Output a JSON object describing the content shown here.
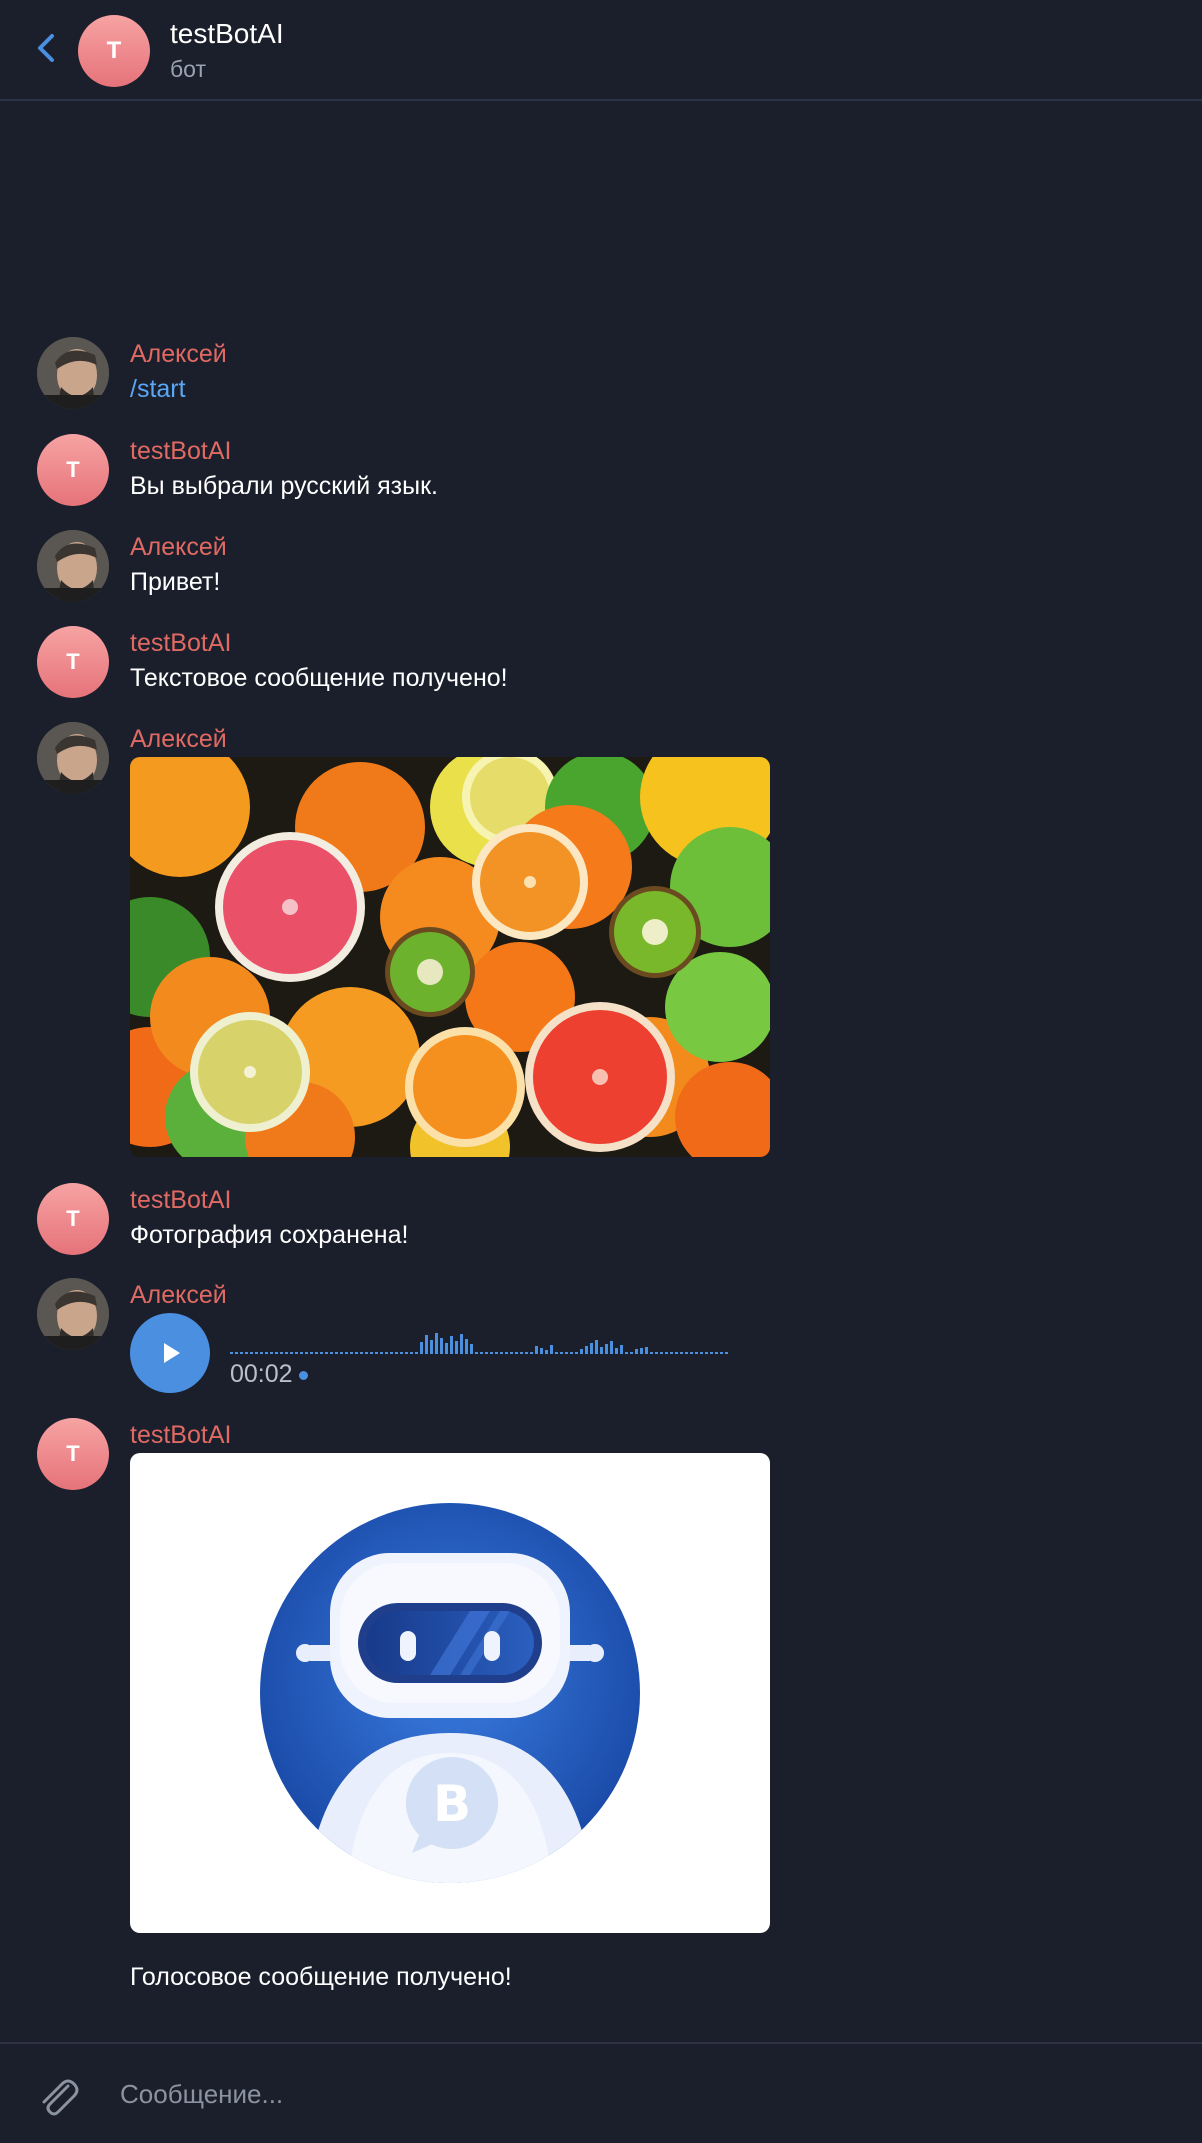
{
  "header": {
    "title": "testBotAI",
    "subtitle": "бот",
    "avatar_letter": "T"
  },
  "messages": [
    {
      "sender": "Алексей",
      "type": "command",
      "text": "/start"
    },
    {
      "sender": "testBotAI",
      "type": "text",
      "text": "Вы выбрали русский язык."
    },
    {
      "sender": "Алексей",
      "type": "text",
      "text": "Привет!"
    },
    {
      "sender": "testBotAI",
      "type": "text",
      "text": "Текстовое сообщение получено!"
    },
    {
      "sender": "Алексей",
      "type": "photo"
    },
    {
      "sender": "testBotAI",
      "type": "text",
      "text": "Фотография сохранена!"
    },
    {
      "sender": "Алексей",
      "type": "voice",
      "duration": "00:02"
    },
    {
      "sender": "testBotAI",
      "type": "photo_with_caption",
      "caption": "Голосовое сообщение получено!"
    }
  ],
  "composer": {
    "placeholder": "Сообщение..."
  },
  "colors": {
    "background": "#1a1f2b",
    "sender_name": "#e06a63",
    "accent": "#4a8fe0",
    "link": "#5aa7f5"
  },
  "icons": {
    "back": "chevron-left-icon",
    "attach": "paperclip-icon",
    "play": "play-icon"
  }
}
